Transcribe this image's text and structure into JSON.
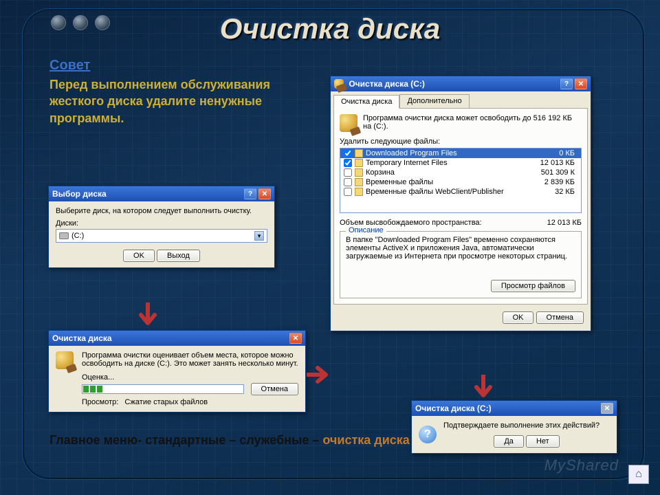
{
  "slide": {
    "title": "Очистка диска",
    "tip_heading": "Совет",
    "tip_body": "Перед выполнением обслуживания жесткого диска удалите ненужные программы.",
    "path_prefix": "Главное меню- стандартные – служебные – ",
    "path_accent": "очистка диска",
    "watermark": "MyShared"
  },
  "select_dialog": {
    "title": "Выбор диска",
    "prompt": "Выберите диск, на котором следует выполнить очистку.",
    "drives_label": "Диски:",
    "selected": "(C:)",
    "ok": "OK",
    "exit": "Выход"
  },
  "scan_dialog": {
    "title": "Очистка диска",
    "message": "Программа очистки оценивает объем места, которое можно освободить на диске (C:). Это может занять несколько минут.",
    "status_label": "Оценка...",
    "cancel": "Отмена",
    "viewing_label": "Просмотр:",
    "viewing_value": "Сжатие старых файлов"
  },
  "cleanup_dialog": {
    "title": "Очистка диска (C:)",
    "tabs": {
      "main": "Очистка диска",
      "more": "Дополнительно"
    },
    "summary": "Программа очистки диска может освободить до 516 192 КБ на (C:).",
    "delete_label": "Удалить следующие файлы:",
    "files": [
      {
        "checked": true,
        "name": "Downloaded Program Files",
        "size": "0 КБ",
        "selected": true
      },
      {
        "checked": true,
        "name": "Temporary Internet Files",
        "size": "12 013 КБ"
      },
      {
        "checked": false,
        "name": "Корзина",
        "size": "501 309 К"
      },
      {
        "checked": false,
        "name": "Временные файлы",
        "size": "2 839 КБ"
      },
      {
        "checked": false,
        "name": "Временные файлы WebClient/Publisher",
        "size": "32 КБ"
      }
    ],
    "freed_label": "Объем высвобождаемого пространства:",
    "freed_value": "12 013 КБ",
    "desc_legend": "Описание",
    "desc_body": "В папке \"Downloaded Program Files\" временно сохраняются элементы ActiveX и приложения Java, автоматически загружаемые из Интернета при просмотре некоторых страниц.",
    "view_files": "Просмотр файлов",
    "ok": "OK",
    "cancel": "Отмена"
  },
  "confirm_dialog": {
    "title": "Очистка диска (C:)",
    "message": "Подтверждаете выполнение этих действий?",
    "yes": "Да",
    "no": "Нет"
  }
}
